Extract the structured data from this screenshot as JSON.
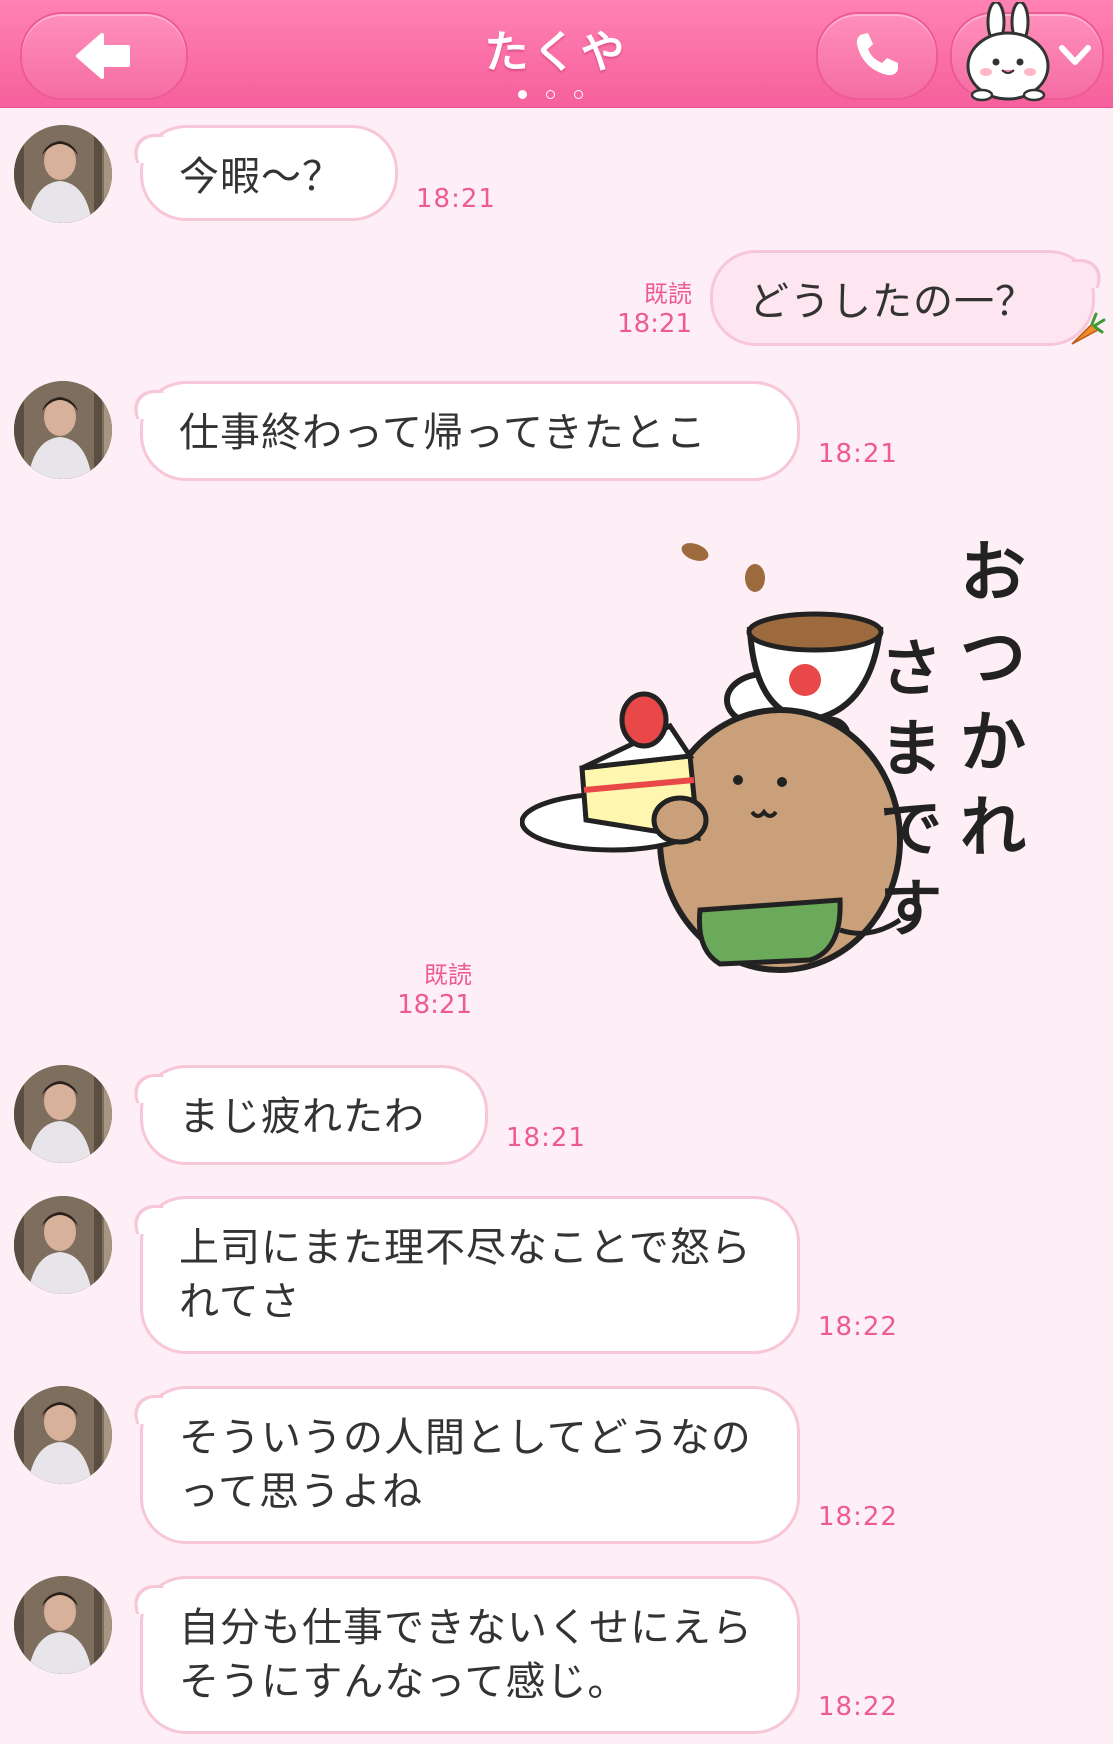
{
  "header": {
    "title": "たくや",
    "page_dots": 3,
    "active_dot": 0,
    "back_icon": "back-arrow-icon",
    "call_icon": "phone-icon",
    "menu_icon": "bunny-chevron-down-icon"
  },
  "colors": {
    "header": "#f6609c",
    "background": "#fdeff5",
    "bubble_border": "#f7c6d9",
    "time_text": "#ee5a95"
  },
  "messages": [
    {
      "side": "in",
      "text": "今暇〜？",
      "time": "18:21"
    },
    {
      "side": "out",
      "text": "どうしたの一？",
      "time": "18:21",
      "read": "既読"
    },
    {
      "side": "in",
      "text": "仕事終わって帰ってきたとこ",
      "time": "18:21"
    },
    {
      "side": "out",
      "sticker": "おつかれさまです",
      "time": "18:21",
      "read": "既読"
    },
    {
      "side": "in",
      "text": "まじ疲れたわ",
      "time": "18:21"
    },
    {
      "side": "in",
      "text": "上司にまた理不尽なことで怒られてさ",
      "time": "18:22"
    },
    {
      "side": "in",
      "text": "そういうの人間としてどうなのって思うよね",
      "time": "18:22"
    },
    {
      "side": "in",
      "text": "自分も仕事できないくせにえらそうにすんなって感じ。",
      "time": "18:22"
    }
  ]
}
